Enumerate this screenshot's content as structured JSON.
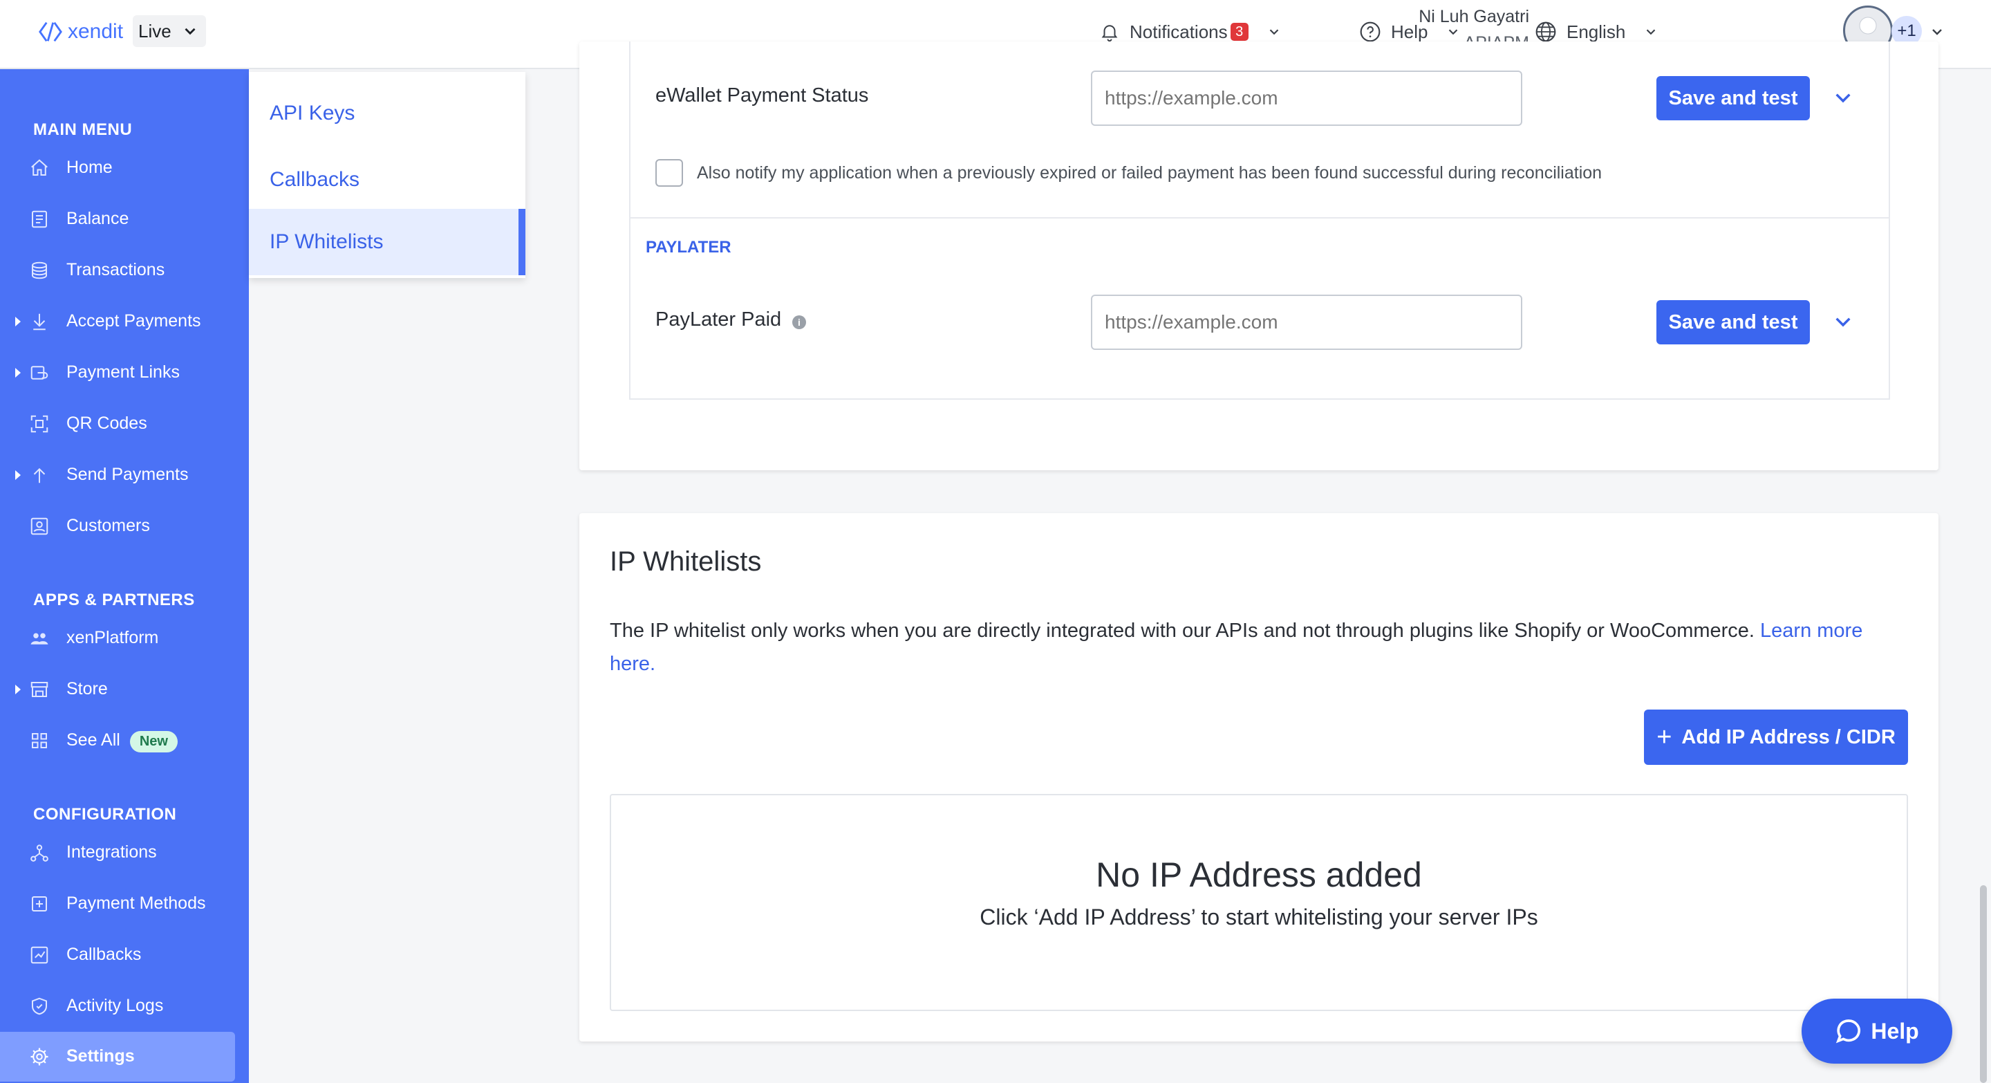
{
  "header": {
    "brand": "xendit",
    "mode": "Live",
    "notifications_label": "Notifications",
    "notifications_count": "3",
    "help_label": "Help",
    "language_label": "English",
    "user_name": "Ni Luh Gayatri",
    "user_org": "APIAPM",
    "extra_accounts": "+1"
  },
  "sidebar": {
    "main_menu_title": "MAIN MENU",
    "main_menu": [
      {
        "label": "Home",
        "icon": "home-icon"
      },
      {
        "label": "Balance",
        "icon": "balance-icon"
      },
      {
        "label": "Transactions",
        "icon": "transactions-icon"
      },
      {
        "label": "Accept Payments",
        "icon": "accept-payments-icon"
      },
      {
        "label": "Payment Links",
        "icon": "payment-links-icon"
      },
      {
        "label": "QR Codes",
        "icon": "qr-code-icon"
      },
      {
        "label": "Send Payments",
        "icon": "send-payments-icon"
      },
      {
        "label": "Customers",
        "icon": "customers-icon"
      }
    ],
    "apps_title": "APPS & PARTNERS",
    "apps": [
      {
        "label": "xenPlatform",
        "icon": "xenplatform-icon"
      },
      {
        "label": "Store",
        "icon": "store-icon"
      },
      {
        "label": "See All",
        "icon": "grid-icon",
        "badge": "New"
      }
    ],
    "config_title": "CONFIGURATION",
    "config": [
      {
        "label": "Integrations",
        "icon": "integrations-icon"
      },
      {
        "label": "Payment Methods",
        "icon": "payment-methods-icon"
      },
      {
        "label": "Callbacks",
        "icon": "callbacks-icon"
      },
      {
        "label": "Activity Logs",
        "icon": "activity-logs-icon"
      },
      {
        "label": "Settings",
        "icon": "gear-icon"
      }
    ]
  },
  "subnav": {
    "items": [
      "API Keys",
      "Callbacks",
      "IP Whitelists"
    ],
    "active": "IP Whitelists"
  },
  "callbacks_card": {
    "ewallet_label": "eWallet Payment Status",
    "ewallet_placeholder": "https://example.com",
    "save_label": "Save and test",
    "reconcile_text": "Also notify my application when a previously expired or failed payment has been found successful during reconciliation",
    "paylater_group": "PAYLATER",
    "paylater_label": "PayLater Paid",
    "paylater_placeholder": "https://example.com"
  },
  "ip_card": {
    "title": "IP Whitelists",
    "description": "The IP whitelist only works when you are directly integrated with our APIs and not through plugins like Shopify or WooCommerce.",
    "learn_more": "Learn more here.",
    "add_button": "Add IP Address / CIDR",
    "empty_title": "No IP Address added",
    "empty_subtitle": "Click ‘Add IP Address’ to start whitelisting your server IPs"
  },
  "help_fab": "Help",
  "colors": {
    "sidebar": "#4b72f6",
    "primary": "#3b66ef",
    "link": "#3a62e8",
    "badge": "#e0373a"
  }
}
